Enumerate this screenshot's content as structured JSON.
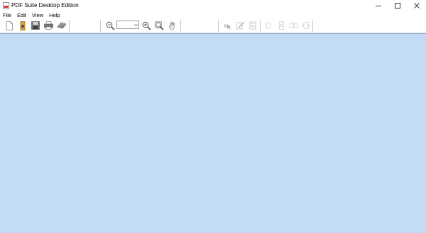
{
  "window": {
    "title": "PDF Suite Desktop Edition",
    "app_icon": "pdf-suite-app-icon",
    "controls": [
      "minimize-icon",
      "maximize-icon",
      "close-icon"
    ]
  },
  "menu": {
    "items": [
      {
        "label": "File"
      },
      {
        "label": "Edit"
      },
      {
        "label": "View"
      },
      {
        "label": "Help"
      }
    ]
  },
  "toolbar": {
    "file_group": [
      "new-document-icon",
      "open-folder-icon",
      "save-icon",
      "print-icon",
      "scan-icon"
    ],
    "zoom_group": [
      "zoom-out-icon",
      "zoom-in-icon",
      "zoom-fit-icon",
      "hand-tool-icon"
    ],
    "zoom_value": "",
    "edit_group": [
      "select-text-icon",
      "edit-text-icon",
      "properties-icon"
    ],
    "layout_group": [
      "single-page-icon",
      "continuous-page-icon",
      "facing-page-icon",
      "fit-width-icon"
    ]
  },
  "colors": {
    "doc_background": "#c3dbf7",
    "window_background": "#ffffff"
  }
}
